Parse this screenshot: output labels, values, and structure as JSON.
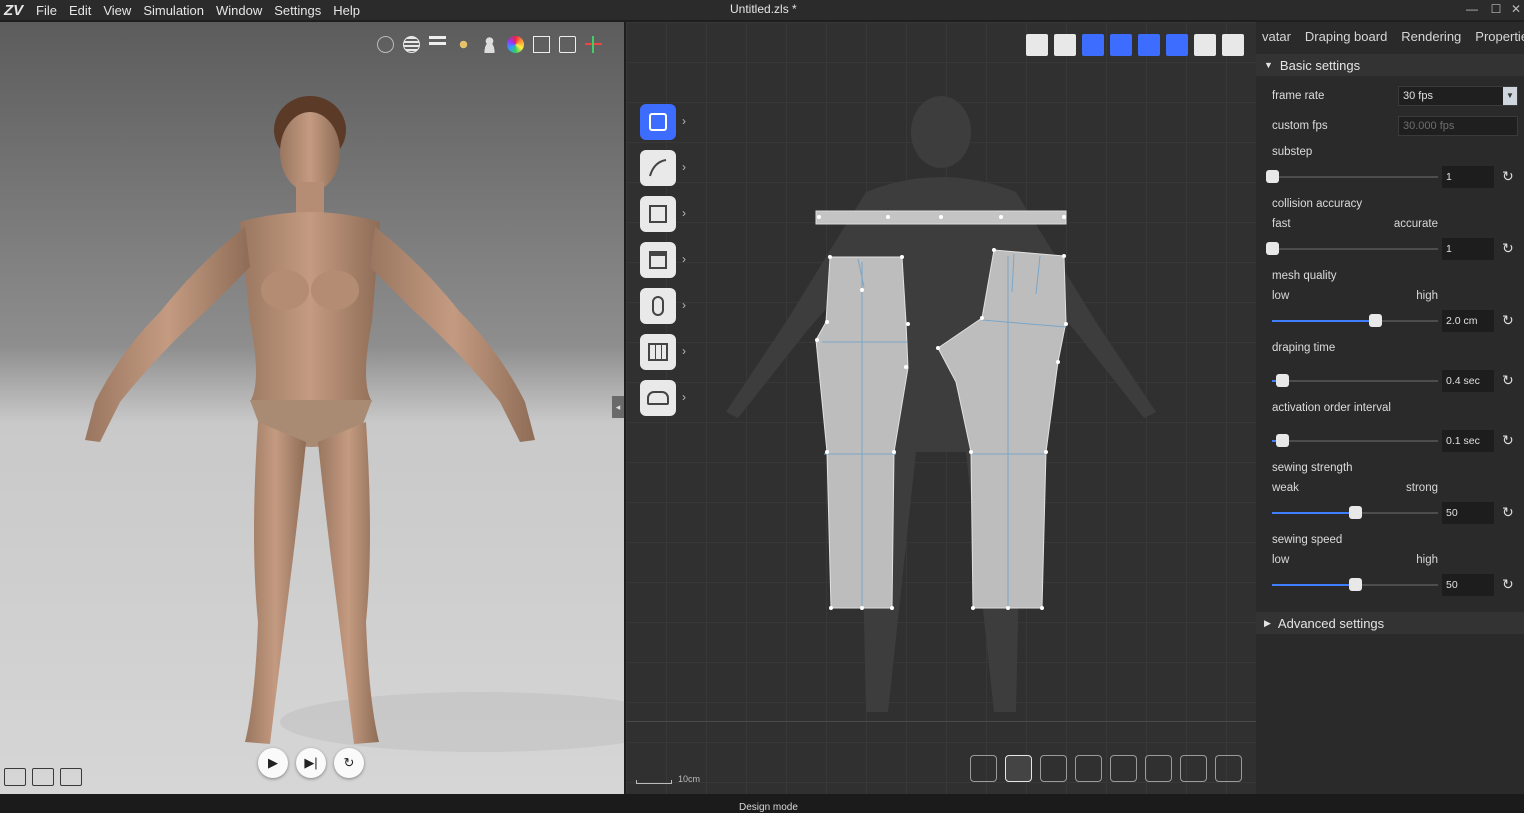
{
  "app": {
    "logo": "ZV",
    "window_title": "Untitled.zls *",
    "menu": [
      "File",
      "Edit",
      "View",
      "Simulation",
      "Window",
      "Settings",
      "Help"
    ]
  },
  "viewport3d": {
    "toolbar_icons": [
      "avatar-icon",
      "sphere-icon",
      "layers-icon",
      "pose-icon",
      "figure-icon",
      "color-wheel-icon",
      "copy-icon",
      "layout-icon",
      "axis-icon"
    ],
    "bottom_icons": [
      "gallery-icon",
      "zoom-search-icon",
      "camera-icon"
    ],
    "playback": {
      "play": "▶",
      "step": "▶|",
      "reset": "↻"
    }
  },
  "pattern2d": {
    "top_icons": [
      "pattern-view-icon",
      "grid-icon",
      "blue-grid-icon",
      "trace-icon",
      "point-icon",
      "frame-icon",
      "print-icon",
      "ruler-icon"
    ],
    "left_tools": [
      "transform-pattern",
      "curve",
      "rectangle",
      "sewing-seam",
      "button",
      "fold",
      "tape-measure"
    ],
    "bottom_tools": [
      "select-pattern",
      "edit-curve",
      "sewing",
      "pin",
      "fold-arrange",
      "line",
      "trace",
      "group"
    ],
    "scale_label": "10cm"
  },
  "panel": {
    "tabs": [
      "vatar",
      "Draping board",
      "Rendering",
      "Properties"
    ],
    "basic_settings": "Basic settings",
    "frame_rate": {
      "label": "frame rate",
      "value": "30 fps"
    },
    "custom_fps": {
      "label": "custom fps",
      "value": "30.000 fps"
    },
    "substep": {
      "label": "substep",
      "value": "1",
      "level": 0
    },
    "collision_accuracy": {
      "label": "collision accuracy",
      "low_label": "fast",
      "high_label": "accurate",
      "value": "1",
      "level": 0
    },
    "mesh_quality": {
      "label": "mesh quality",
      "low_label": "low",
      "high_label": "high",
      "value": "2.0 cm",
      "level": 0.62
    },
    "draping_time": {
      "label": "draping time",
      "value": "0.4 sec",
      "level": 0.06
    },
    "activation_order_interval": {
      "label": "activation order interval",
      "value": "0.1 sec",
      "level": 0.06
    },
    "sewing_strength": {
      "label": "sewing strength",
      "low_label": "weak",
      "high_label": "strong",
      "value": "50",
      "level": 0.5
    },
    "sewing_speed": {
      "label": "sewing speed",
      "low_label": "low",
      "high_label": "high",
      "value": "50",
      "level": 0.5
    },
    "advanced_settings": "Advanced settings"
  },
  "status": {
    "mode": "Design mode"
  },
  "colors": {
    "accent": "#3f7eff",
    "active_tool": "#3d6dff"
  }
}
